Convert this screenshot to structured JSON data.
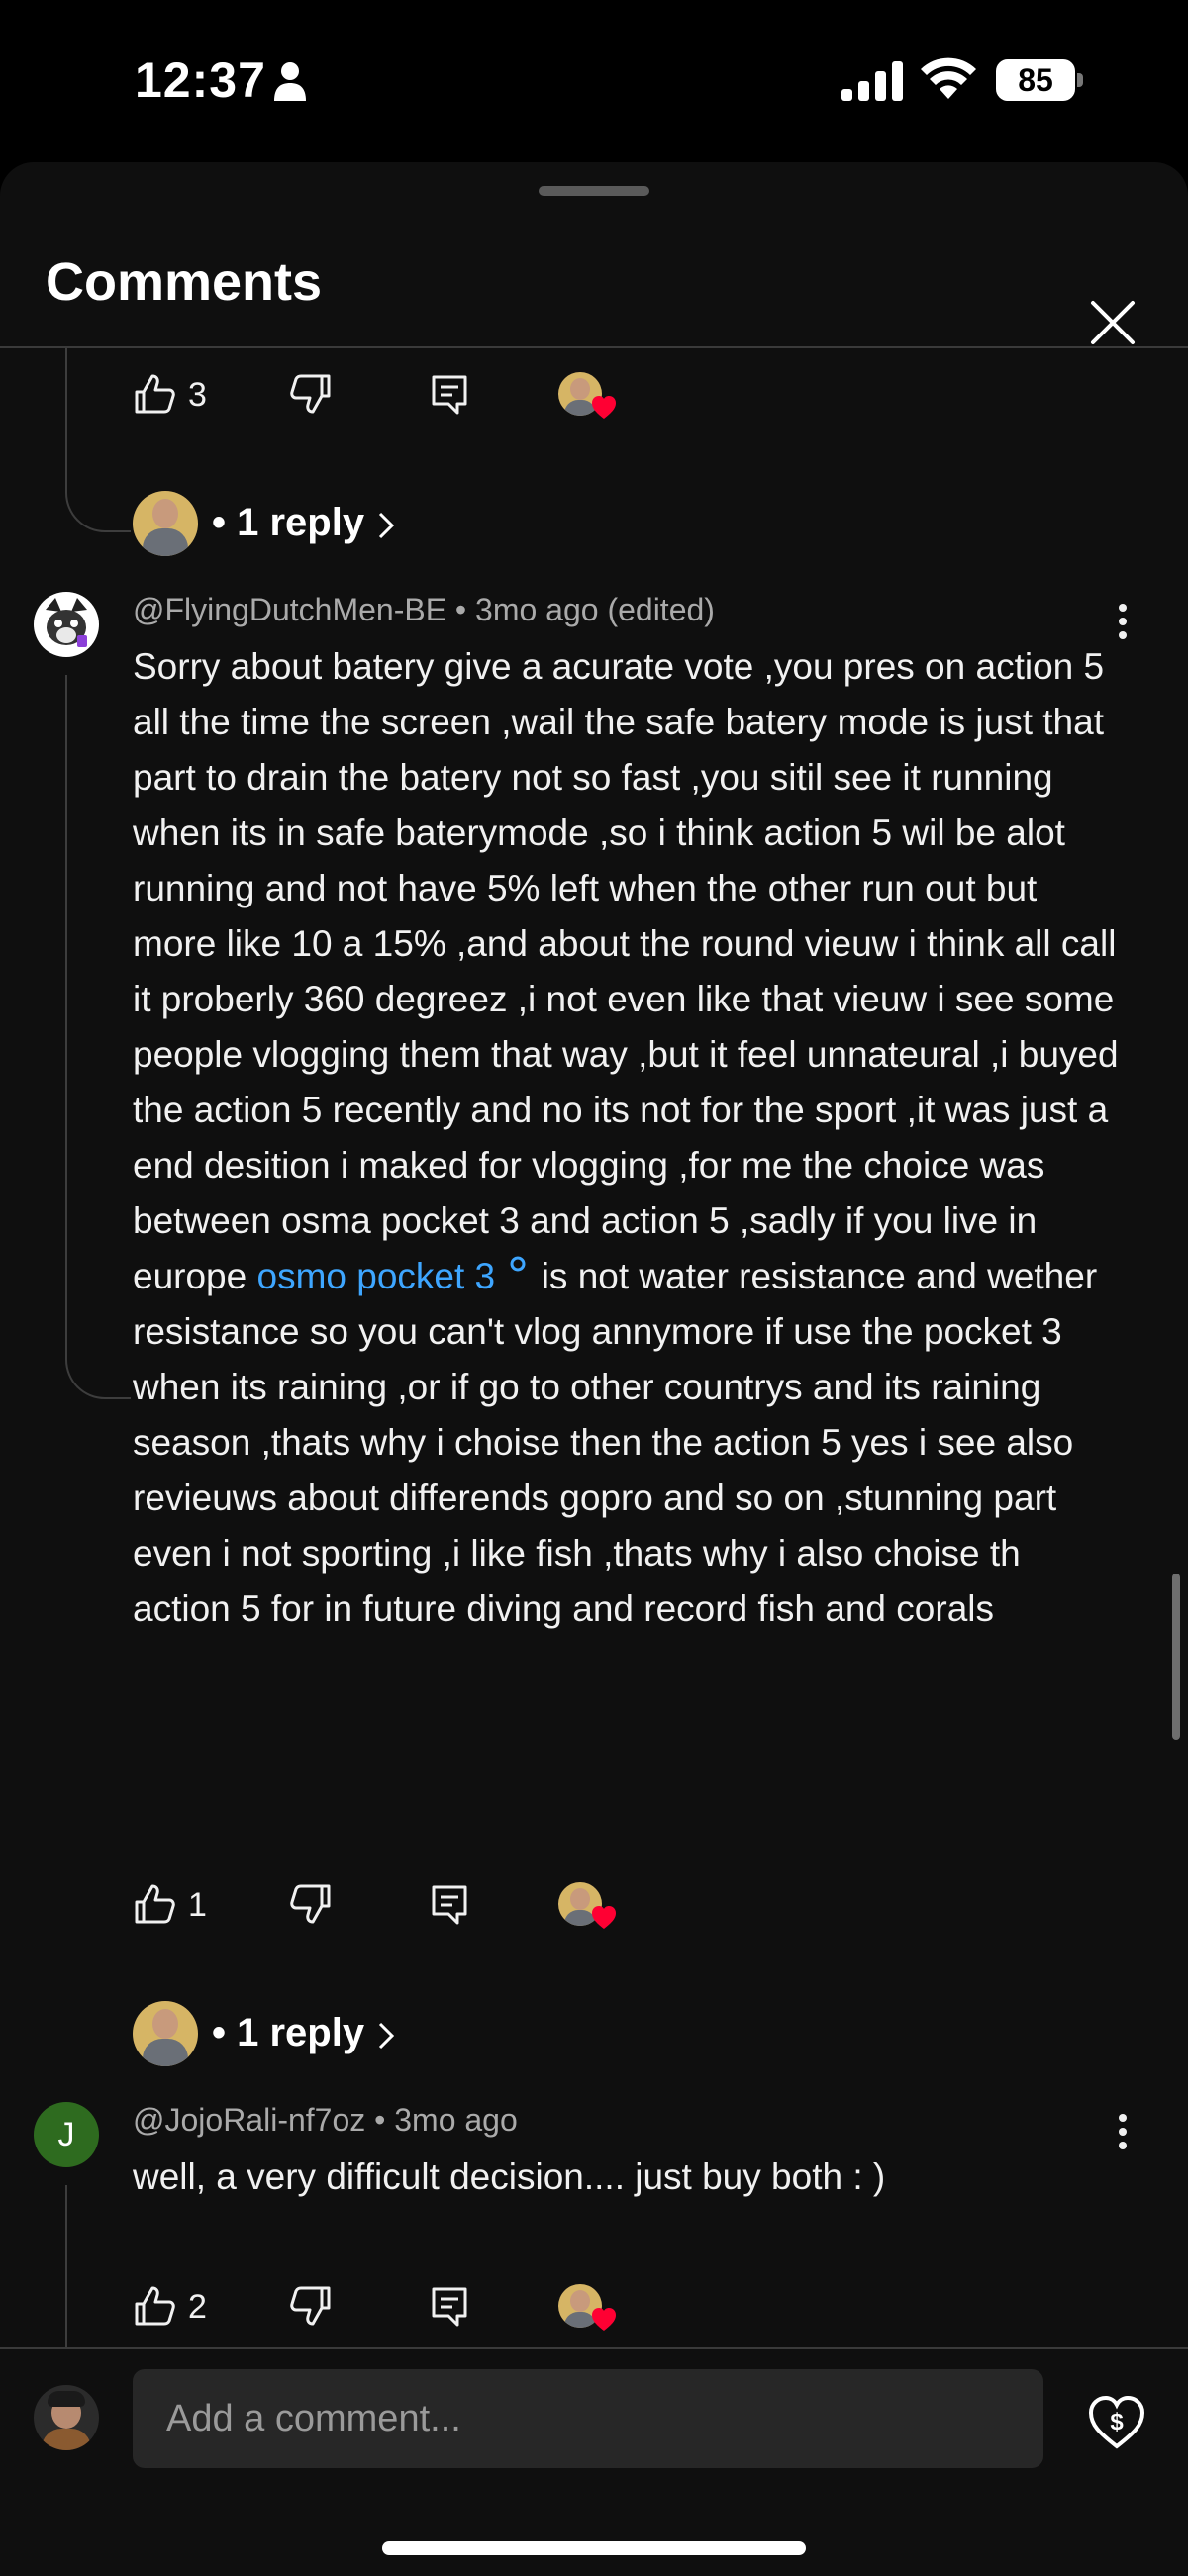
{
  "status_bar": {
    "time": "12:37",
    "battery": "85",
    "icons": [
      "person-icon",
      "signal-icon",
      "wifi-icon",
      "battery-icon"
    ]
  },
  "sheet": {
    "title": "Comments",
    "close_icon": "close-icon"
  },
  "top_partial": {
    "like_count": "3",
    "replies_label": "• 1 reply"
  },
  "comments": [
    {
      "author": "@FlyingDutchMen-BE",
      "meta": "• 3mo ago (edited)",
      "text_before_link": "Sorry about batery give a acurate vote ,you pres on action 5 all the time the screen ,wail the safe batery mode is just that part to drain the batery not so fast ,you sitil see it running when its in safe baterymode ,so i think action 5 wil be alot running and not have 5% left when the other run out but more like 10 a 15% ,and about the round vieuw i think all call it proberly 360 degreez ,i not even like that vieuw i see some people vlogging them that way ,but it feel unnateural ,i buyed the action 5 recently and no its not for the sport ,it was just a end desition i maked for vlogging ,for me the choice was between osma pocket 3 and action 5 ,sadly if you live in europe ",
      "link_text": "osmo pocket 3",
      "text_after_link": " is not water resistance and wether resistance so you can't vlog annymore if use the pocket 3 when its raining ,or if go to other countrys and its raining season  ,thats why i choise then the action 5 yes i see also revieuws about differends gopro and so on ,stunning part even i not sporting ,i like fish ,thats why i also choise th action 5 for in future diving and record fish and corals",
      "like_count": "1",
      "replies_label": "• 1 reply"
    },
    {
      "author": "@JojoRali-nf7oz",
      "meta": "• 3mo ago",
      "avatar_letter": "J",
      "avatar_color": "#2e6b1f",
      "text": "well, a very difficult decision.... just buy both : )",
      "like_count": "2"
    }
  ],
  "composer": {
    "placeholder": "Add a comment..."
  },
  "colors": {
    "background": "#0f0f0f",
    "link": "#3ea6ff",
    "heart": "#ff0033"
  }
}
